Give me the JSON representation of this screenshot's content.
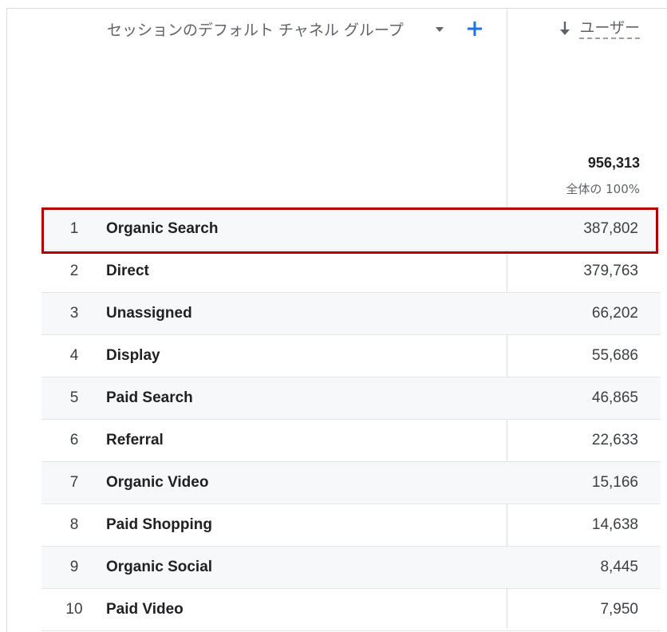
{
  "header": {
    "dimension_label": "セッションのデフォルト チャネル グループ",
    "metric_label": "ユーザー"
  },
  "totals": {
    "value": "956,313",
    "percent_label": "全体の 100%"
  },
  "rows": [
    {
      "rank": "1",
      "channel": "Organic Search",
      "users": "387,802"
    },
    {
      "rank": "2",
      "channel": "Direct",
      "users": "379,763"
    },
    {
      "rank": "3",
      "channel": "Unassigned",
      "users": "66,202"
    },
    {
      "rank": "4",
      "channel": "Display",
      "users": "55,686"
    },
    {
      "rank": "5",
      "channel": "Paid Search",
      "users": "46,865"
    },
    {
      "rank": "6",
      "channel": "Referral",
      "users": "22,633"
    },
    {
      "rank": "7",
      "channel": "Organic Video",
      "users": "15,166"
    },
    {
      "rank": "8",
      "channel": "Paid Shopping",
      "users": "14,638"
    },
    {
      "rank": "9",
      "channel": "Organic Social",
      "users": "8,445"
    },
    {
      "rank": "10",
      "channel": "Paid Video",
      "users": "7,950"
    }
  ],
  "colors": {
    "accent": "#1a73e8",
    "highlight": "#b00000",
    "shaded_row": "#f7f8fa",
    "divider": "#dadce0"
  },
  "icons": {
    "dimension_menu": "caret-down-icon",
    "add_dimension": "plus-icon",
    "sort_direction": "arrow-down-icon"
  }
}
